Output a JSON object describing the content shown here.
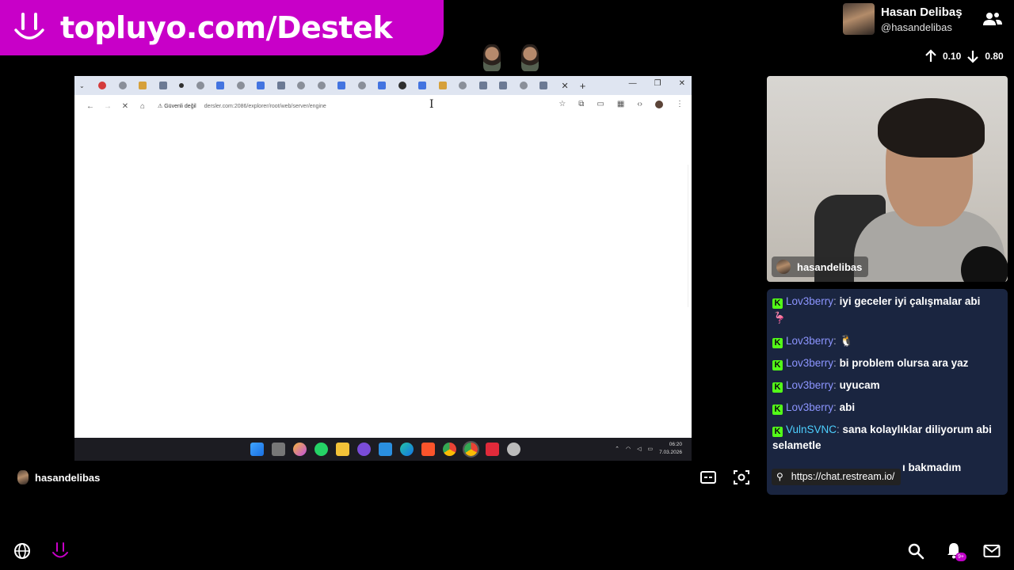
{
  "banner": {
    "text": "topluyo.com/Destek"
  },
  "profile": {
    "name": "Hasan Delibaş",
    "handle": "@hasandelibas"
  },
  "stats": {
    "up": "0.10",
    "down": "0.80"
  },
  "browser": {
    "security_label": "Güvenli değil",
    "url": "dersler.com:2086/explorer/root/web/server/engine",
    "tab_close": "✕",
    "tab_new": "+",
    "win_min": "—",
    "win_max": "❐",
    "win_close": "✕"
  },
  "taskbar": {
    "time": "06:20",
    "date": "7.03.2026"
  },
  "webcam": {
    "username": "hasandelibas"
  },
  "chat": {
    "messages": [
      {
        "user": "Lov3berry",
        "text": "iyi geceler iyi çalışmalar abi",
        "emoji": "🦩"
      },
      {
        "user": "Lov3berry",
        "text": "",
        "emoji": "🐧"
      },
      {
        "user": "Lov3berry",
        "text": "bi problem olursa ara yaz",
        "emoji": ""
      },
      {
        "user": "Lov3berry",
        "text": "uyucam",
        "emoji": ""
      },
      {
        "user": "Lov3berry",
        "text": "abi",
        "emoji": ""
      },
      {
        "user": "VulnSVNC",
        "text": "sana kolaylıklar diliyorum abi selametle",
        "emoji": ""
      },
      {
        "user": "",
        "text": "ı bakmadım",
        "emoji": ""
      }
    ],
    "tooltip_url": "https://chat.restream.io/"
  },
  "host": {
    "name": "hasandelibas"
  },
  "notifications": {
    "badge": "9+"
  },
  "colors": {
    "brand": "#c800c8",
    "chat_bg": "#1a2540",
    "kick_green": "#53fc18",
    "username": "#8c95ff"
  }
}
